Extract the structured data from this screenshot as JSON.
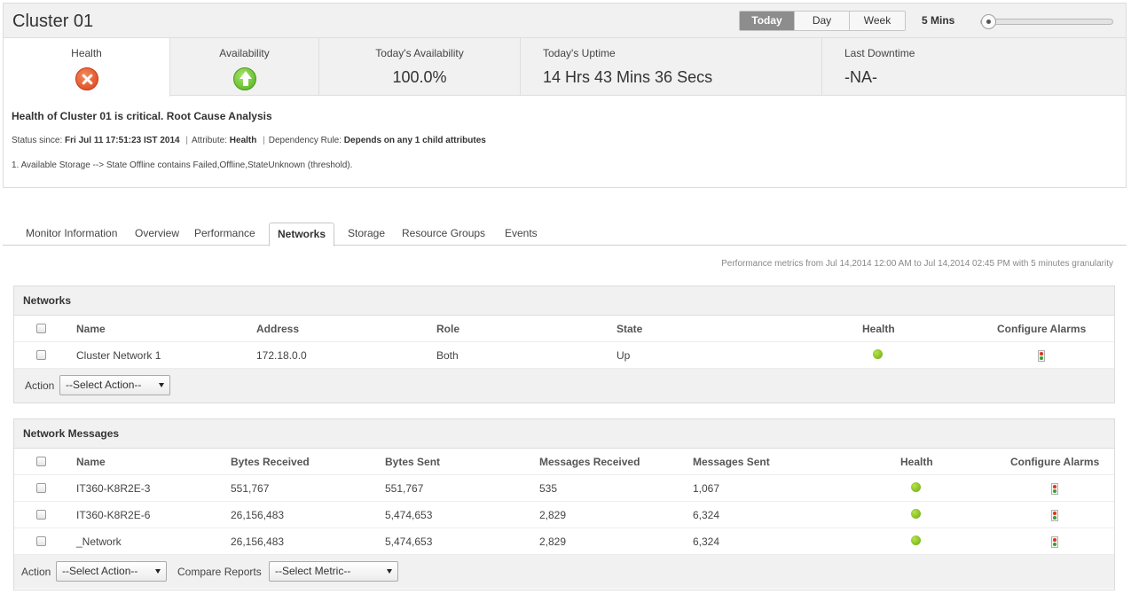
{
  "header": {
    "title": "Cluster 01",
    "periods": [
      "Today",
      "Day",
      "Week"
    ],
    "active_period": "Today",
    "interval": "5 Mins",
    "slider_position": 0.0
  },
  "stats": {
    "health_label": "Health",
    "health_icon": "critical-x-icon",
    "availability_label": "Availability",
    "availability_icon": "up-arrow-icon",
    "today_availability_label": "Today's Availability",
    "today_availability_value": "100.0%",
    "today_uptime_label": "Today's Uptime",
    "today_uptime_value": "14 Hrs 43 Mins 36 Secs",
    "last_downtime_label": "Last Downtime",
    "last_downtime_value": "-NA-"
  },
  "rca": {
    "title": "Health of Cluster 01 is critical. Root Cause Analysis",
    "status_since_label": "Status since:",
    "status_since_value": "Fri Jul 11 17:51:23 IST 2014",
    "attribute_label": "Attribute:",
    "attribute_value": "Health",
    "dependency_label": "Dependency Rule:",
    "dependency_value": "Depends on any 1 child attributes",
    "threshold": "1. Available Storage --> State Offline contains Failed,Offline,StateUnknown (threshold)."
  },
  "tabs": [
    "Monitor Information",
    "Overview",
    "Performance",
    "Networks",
    "Storage",
    "Resource Groups",
    "Events"
  ],
  "active_tab": "Networks",
  "perf_note": "Performance metrics from Jul 14,2014 12:00 AM to Jul 14,2014 02:45 PM with 5 minutes granularity",
  "networks": {
    "title": "Networks",
    "columns": [
      "Name",
      "Address",
      "Role",
      "State",
      "Health",
      "Configure Alarms"
    ],
    "rows": [
      {
        "name": "Cluster Network 1",
        "address": "172.18.0.0",
        "role": "Both",
        "state": "Up",
        "health": "green"
      }
    ],
    "action_label": "Action",
    "action_select": "--Select Action--"
  },
  "messages": {
    "title": "Network Messages",
    "columns": [
      "Name",
      "Bytes Received",
      "Bytes Sent",
      "Messages Received",
      "Messages Sent",
      "Health",
      "Configure Alarms"
    ],
    "rows": [
      {
        "name": "IT360-K8R2E-3",
        "bytes_received": "551,767",
        "bytes_sent": "551,767",
        "messages_received": "535",
        "messages_sent": "1,067",
        "health": "green"
      },
      {
        "name": "IT360-K8R2E-6",
        "bytes_received": "26,156,483",
        "bytes_sent": "5,474,653",
        "messages_received": "2,829",
        "messages_sent": "6,324",
        "health": "green"
      },
      {
        "name": "_Network",
        "bytes_received": "26,156,483",
        "bytes_sent": "5,474,653",
        "messages_received": "2,829",
        "messages_sent": "6,324",
        "health": "green"
      }
    ],
    "action_label": "Action",
    "action_select": "--Select Action--",
    "compare_label": "Compare Reports",
    "metric_select": "--Select Metric--"
  },
  "colors": {
    "health_green": "#7cbd1f",
    "critical_red": "#e2502a",
    "active_period_bg": "#8d8d8d"
  }
}
